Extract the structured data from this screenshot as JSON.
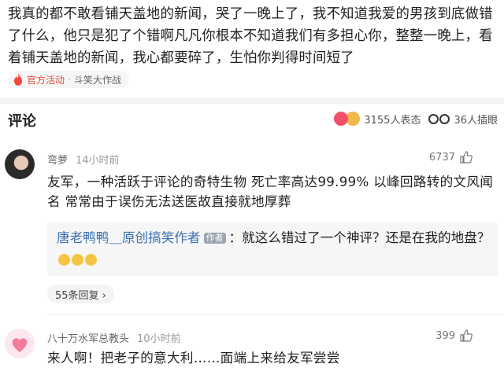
{
  "post": {
    "text": "我真的都不敢看铺天盖地的新闻，哭了一晚上了，我不知道我爱的男孩到底做错了什么，他只是犯了个错啊凡凡你根本不知道我们有多担心你，整整一晚上，看着铺天盖地的新闻，我心都要碎了，生怕你判得时间短了",
    "tag_activity": "官方活动",
    "tag_topic": "斗笑大作战"
  },
  "comments_header": {
    "title": "评论",
    "reactions_count": "3155人表态",
    "insert_count": "36人插眼"
  },
  "comments": [
    {
      "user": "弯萝",
      "time": "14小时前",
      "likes": "6737",
      "text": "友军，一种活跃于评论的奇特生物 死亡率高达99.99% 以峰回路转的文风闻名 常常由于误伤无法送医故直接就地厚葬",
      "reply": {
        "name": "唐老鸭鸭＿原创搞笑作者",
        "badge": "作者",
        "text": "：就这么错过了一个神评？还是在我的地盘？"
      },
      "more_replies": "55条回复 ›"
    },
    {
      "user": "八十万水军总教头",
      "time": "10小时前",
      "likes": "399",
      "text": "来人啊！把老子的意大利……面端上来给友军尝尝"
    }
  ],
  "colors": {
    "accent": "#f04a3a",
    "link": "#3a6fb0"
  }
}
